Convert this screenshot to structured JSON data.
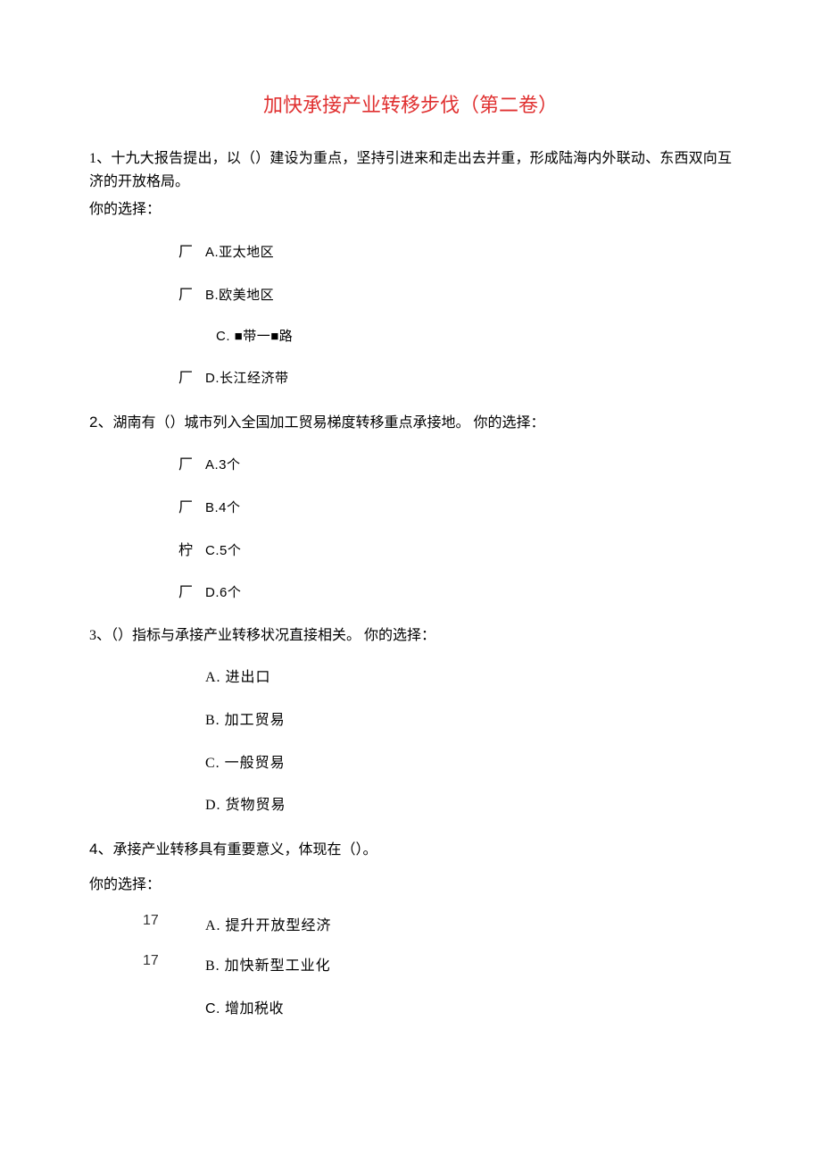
{
  "title": "加快承接产业转移步伐（第二卷）",
  "q1": {
    "num": "1、",
    "stem": "十九大报告提出，以（）建设为重点，坚持引进来和走出去并重，形成陆海内外联动、东西双向互济的开放格局。",
    "choice": "你的选择：",
    "opts": {
      "a_m": "厂",
      "a": "A.亚太地区",
      "b_m": "厂",
      "b": "B.欧美地区",
      "c_m": "",
      "c": "C. ■带一■路",
      "d_m": "厂",
      "d": "D.长江经济带"
    }
  },
  "q2": {
    "num": "2、",
    "stem": "湖南有（）城市列入全国加工贸易梯度转移重点承接地。 你的选择：",
    "opts": {
      "a_m": "厂",
      "a": "A.3个",
      "b_m": "厂",
      "b": "B.4个",
      "c_m": "柠",
      "c": "C.5个",
      "d_m": "厂",
      "d": "D.6个"
    }
  },
  "q3": {
    "num": "3、",
    "stem": "（）指标与承接产业转移状况直接相关。 你的选择：",
    "opts": {
      "a": "A. 进出口",
      "b": "B. 加工贸易",
      "c": "C. 一般贸易",
      "d": "D. 货物贸易"
    }
  },
  "q4": {
    "num": "4、",
    "stem": "承接产业转移具有重要意义，体现在（）。",
    "choice": "你的选择：",
    "opts": {
      "a_n": "17",
      "a": "A. 提升开放型经济",
      "b_n": "17",
      "b": "B. 加快新型工业化",
      "c_n": "",
      "c": "C. 增加税收"
    }
  }
}
